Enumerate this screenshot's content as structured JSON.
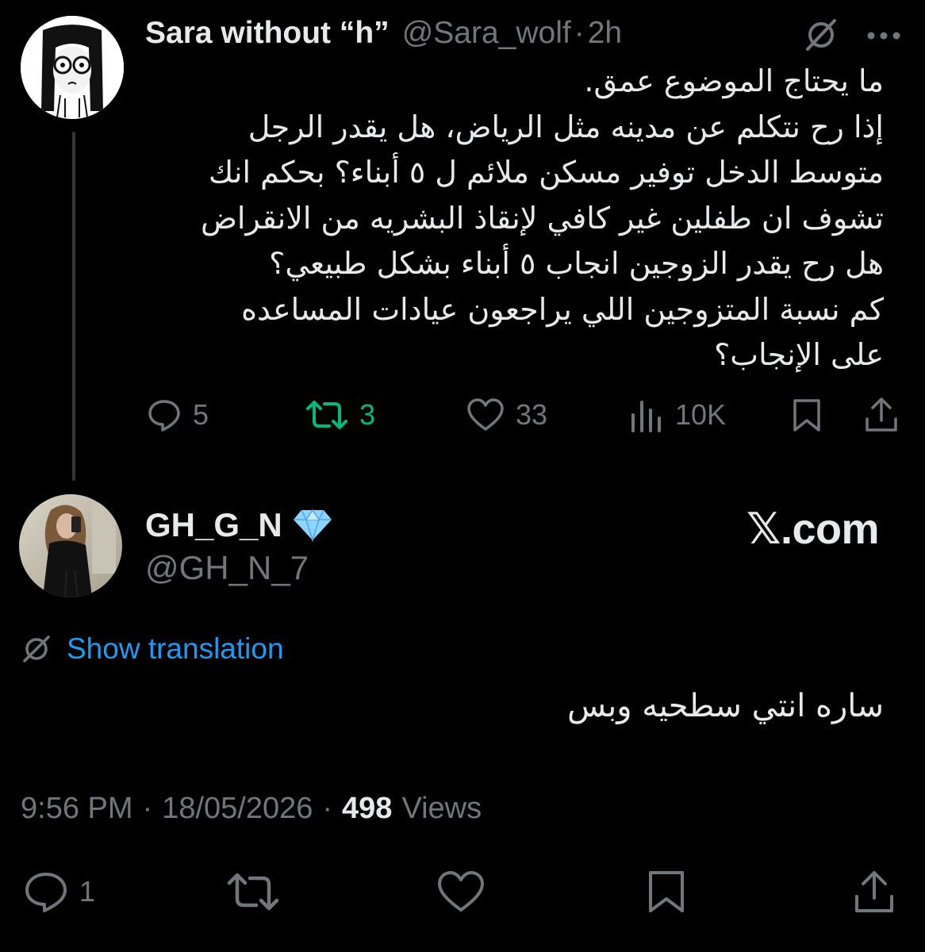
{
  "parent_tweet": {
    "author_name": "Sara without “h”",
    "handle": "@Sara_wolf",
    "separator": "·",
    "time": "2h",
    "body_lines": [
      "ما يحتاج الموضوع عمق.",
      "إذا رح نتكلم عن مدينه مثل الرياض، هل يقدر الرجل",
      "متوسط الدخل توفير مسكن ملائم ل ٥ أبناء؟ بحكم انك",
      "تشوف ان طفلين غير كافي لإنقاذ البشريه من الانقراض",
      "هل رح يقدر الزوجين انجاب ٥ أبناء بشكل طبيعي؟",
      "كم نسبة المتزوجين اللي يراجعون عيادات المساعده",
      "على الإنجاب؟"
    ],
    "actions": {
      "replies": "5",
      "reposts": "3",
      "likes": "33",
      "views": "10K"
    },
    "icons": [
      "grok-translate-icon",
      "more-icon",
      "reply-icon",
      "repost-icon",
      "like-icon",
      "views-icon",
      "bookmark-icon",
      "share-icon"
    ]
  },
  "reply_tweet": {
    "author_name": "GH_G_N",
    "badge": "diamond-emoji",
    "handle": "@GH_N_7",
    "watermark": "𝕏.com",
    "show_translation": "Show translation",
    "body": "ساره انتي سطحيه وبس",
    "timestamp": "9:56 PM",
    "date": "18/05/2026",
    "meta_separator": "·",
    "views_count": "498",
    "views_label": "Views",
    "actions": {
      "replies": "1"
    }
  },
  "colors": {
    "background": "#000000",
    "text_primary": "#e7e9ea",
    "text_secondary": "#71767b",
    "link": "#1d9bf0",
    "repost_active": "#00ba7c",
    "thread_line": "#333639"
  }
}
